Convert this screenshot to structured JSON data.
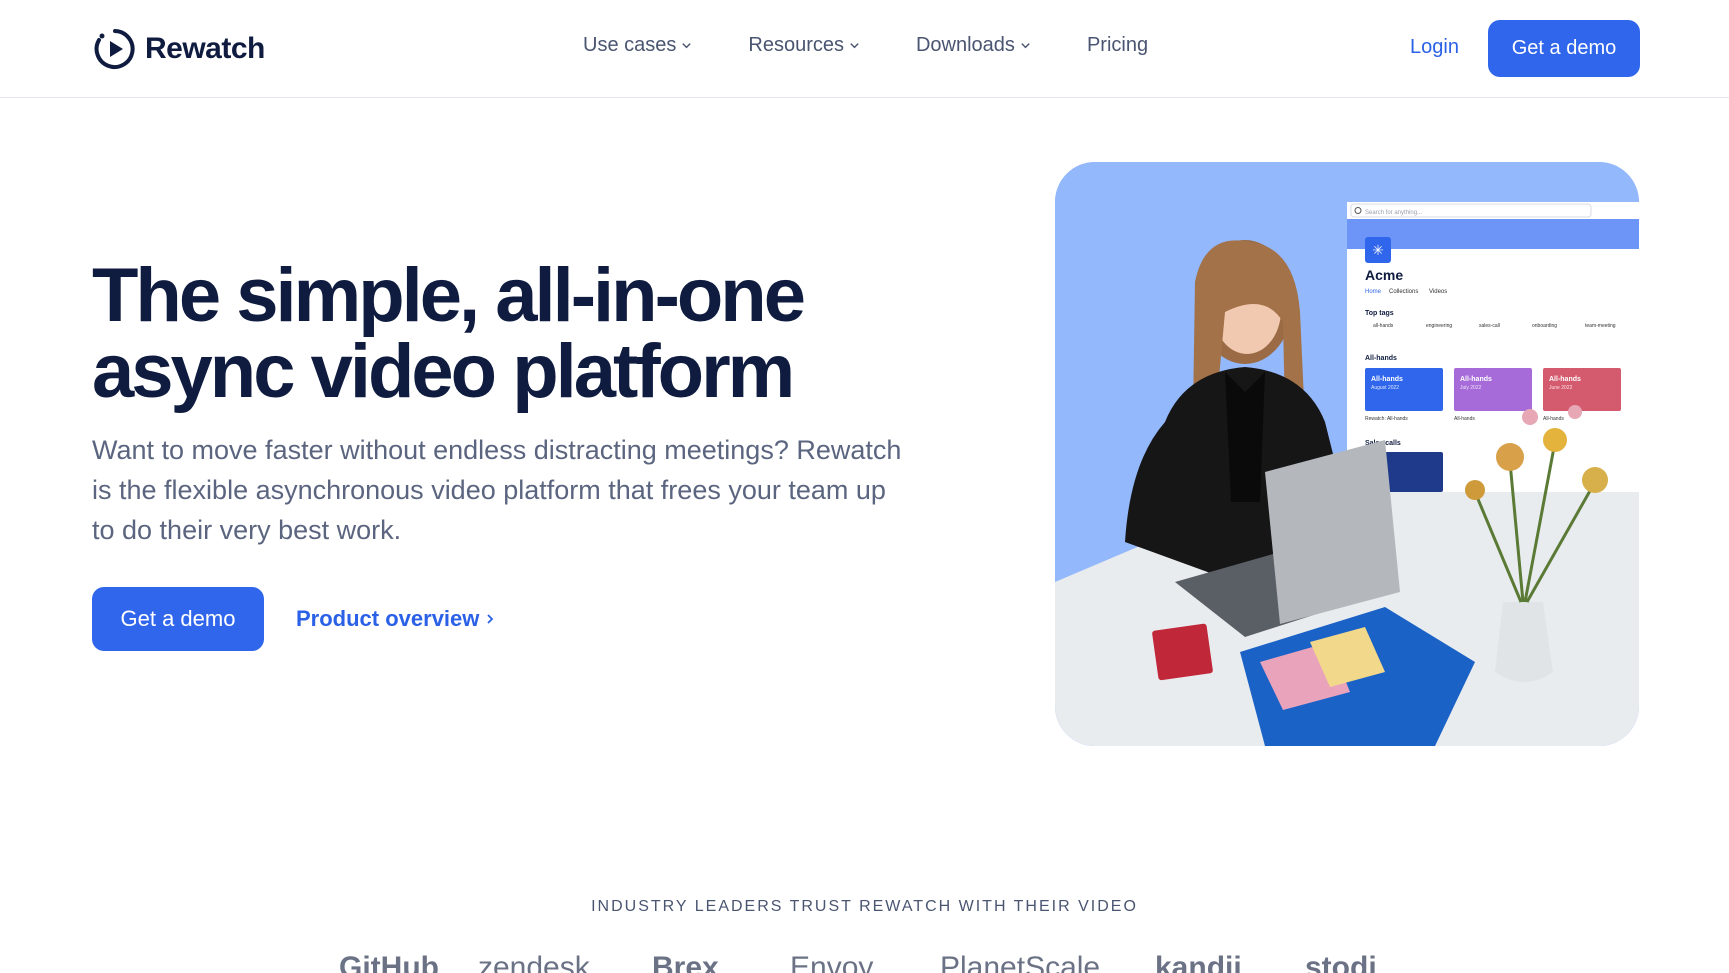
{
  "header": {
    "brand": "Rewatch",
    "nav": [
      {
        "label": "Use cases",
        "has_dropdown": true
      },
      {
        "label": "Resources",
        "has_dropdown": true
      },
      {
        "label": "Downloads",
        "has_dropdown": true
      },
      {
        "label": "Pricing",
        "has_dropdown": false
      }
    ],
    "login_label": "Login",
    "cta_label": "Get a demo"
  },
  "hero": {
    "headline_line1": "The simple, all-in-one",
    "headline_line2": "async video platform",
    "subtext": "Want to move faster without endless distracting meetings? Rewatch is the flexible asynchronous video platform that frees your team up to do their very best work.",
    "cta_label": "Get a demo",
    "link_label": "Product overview"
  },
  "mockup": {
    "search_placeholder": "Search for anything...",
    "workspace": "Acme",
    "tabs": [
      "Home",
      "Collections",
      "Videos"
    ],
    "top_tags_label": "Top tags",
    "tags": [
      "all-hands",
      "engineering",
      "sales-call",
      "onboarding",
      "team-meeting"
    ],
    "all_hands_label": "All-hands",
    "cards": [
      {
        "title": "All-hands",
        "subtitle": "August 2022",
        "caption": "Rewatch: All-hands",
        "color": "#2f66ec"
      },
      {
        "title": "All-hands",
        "subtitle": "July 2022",
        "caption": "All-hands",
        "color": "#a66bd9"
      },
      {
        "title": "All-hands",
        "subtitle": "June 2022",
        "caption": "All-hands",
        "color": "#d45a6e"
      }
    ],
    "sales_calls_label": "Sales calls"
  },
  "trust": {
    "label": "INDUSTRY LEADERS TRUST REWATCH WITH THEIR VIDEO",
    "logos": [
      "GitHub",
      "zendesk",
      "Brex",
      "Envoy",
      "PlanetScale",
      "kandji",
      "stodi"
    ]
  },
  "colors": {
    "primary": "#2f66ec",
    "heading": "#0f1c3f",
    "body": "#5b6580",
    "hero_bg": "#93b8fb"
  }
}
